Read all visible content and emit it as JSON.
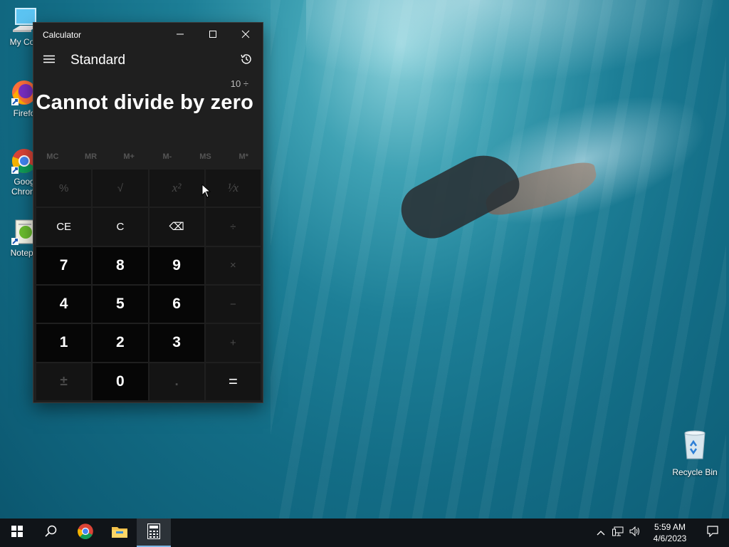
{
  "desktop": {
    "icons": [
      {
        "label": "My Com",
        "icon": "computer-icon"
      },
      {
        "label": "Firefo",
        "icon": "firefox-icon"
      },
      {
        "label": "Goog Chrom",
        "icon": "chrome-icon"
      },
      {
        "label": "Notepa",
        "icon": "notepad-icon"
      }
    ],
    "recycle_bin": {
      "label": "Recycle Bin",
      "icon": "recycle-bin-icon"
    }
  },
  "calculator": {
    "title": "Calculator",
    "mode": "Standard",
    "expression": "10 ÷",
    "result": "Cannot divide by zero",
    "memory": [
      "MC",
      "MR",
      "M+",
      "M-",
      "MS",
      "M*"
    ],
    "keys": [
      {
        "label": "%",
        "name": "percent-key",
        "kind": "op",
        "enabled": false
      },
      {
        "label": "√",
        "name": "sqrt-key",
        "kind": "op",
        "enabled": false
      },
      {
        "label": "x²",
        "name": "square-key",
        "kind": "op",
        "enabled": false
      },
      {
        "label": "¹⁄x",
        "name": "reciprocal-key",
        "kind": "op",
        "enabled": false
      },
      {
        "label": "CE",
        "name": "clear-entry-key",
        "kind": "op",
        "enabled": true
      },
      {
        "label": "C",
        "name": "clear-key",
        "kind": "op",
        "enabled": true
      },
      {
        "label": "⌫",
        "name": "backspace-key",
        "kind": "op",
        "enabled": true
      },
      {
        "label": "÷",
        "name": "divide-key",
        "kind": "op",
        "enabled": false
      },
      {
        "label": "7",
        "name": "digit-7-key",
        "kind": "num",
        "enabled": true
      },
      {
        "label": "8",
        "name": "digit-8-key",
        "kind": "num",
        "enabled": true
      },
      {
        "label": "9",
        "name": "digit-9-key",
        "kind": "num",
        "enabled": true
      },
      {
        "label": "×",
        "name": "multiply-key",
        "kind": "op",
        "enabled": false
      },
      {
        "label": "4",
        "name": "digit-4-key",
        "kind": "num",
        "enabled": true
      },
      {
        "label": "5",
        "name": "digit-5-key",
        "kind": "num",
        "enabled": true
      },
      {
        "label": "6",
        "name": "digit-6-key",
        "kind": "num",
        "enabled": true
      },
      {
        "label": "−",
        "name": "subtract-key",
        "kind": "op",
        "enabled": false
      },
      {
        "label": "1",
        "name": "digit-1-key",
        "kind": "num",
        "enabled": true
      },
      {
        "label": "2",
        "name": "digit-2-key",
        "kind": "num",
        "enabled": true
      },
      {
        "label": "3",
        "name": "digit-3-key",
        "kind": "num",
        "enabled": true
      },
      {
        "label": "+",
        "name": "add-key",
        "kind": "op",
        "enabled": false
      },
      {
        "label": "±",
        "name": "negate-key",
        "kind": "num",
        "enabled": false
      },
      {
        "label": "0",
        "name": "digit-0-key",
        "kind": "num",
        "enabled": true
      },
      {
        "label": ".",
        "name": "decimal-key",
        "kind": "num",
        "enabled": false
      },
      {
        "label": "=",
        "name": "equals-key",
        "kind": "op",
        "enabled": true
      }
    ]
  },
  "taskbar": {
    "apps": [
      "start-icon",
      "search-icon",
      "chrome-icon",
      "file-explorer-icon",
      "calculator-icon"
    ],
    "clock": {
      "time": "5:59 AM",
      "date": "4/6/2023"
    }
  },
  "colors": {
    "accent": "#7fb7e6",
    "calc_bg": "#1f1f1f",
    "taskbar": "#101418"
  }
}
